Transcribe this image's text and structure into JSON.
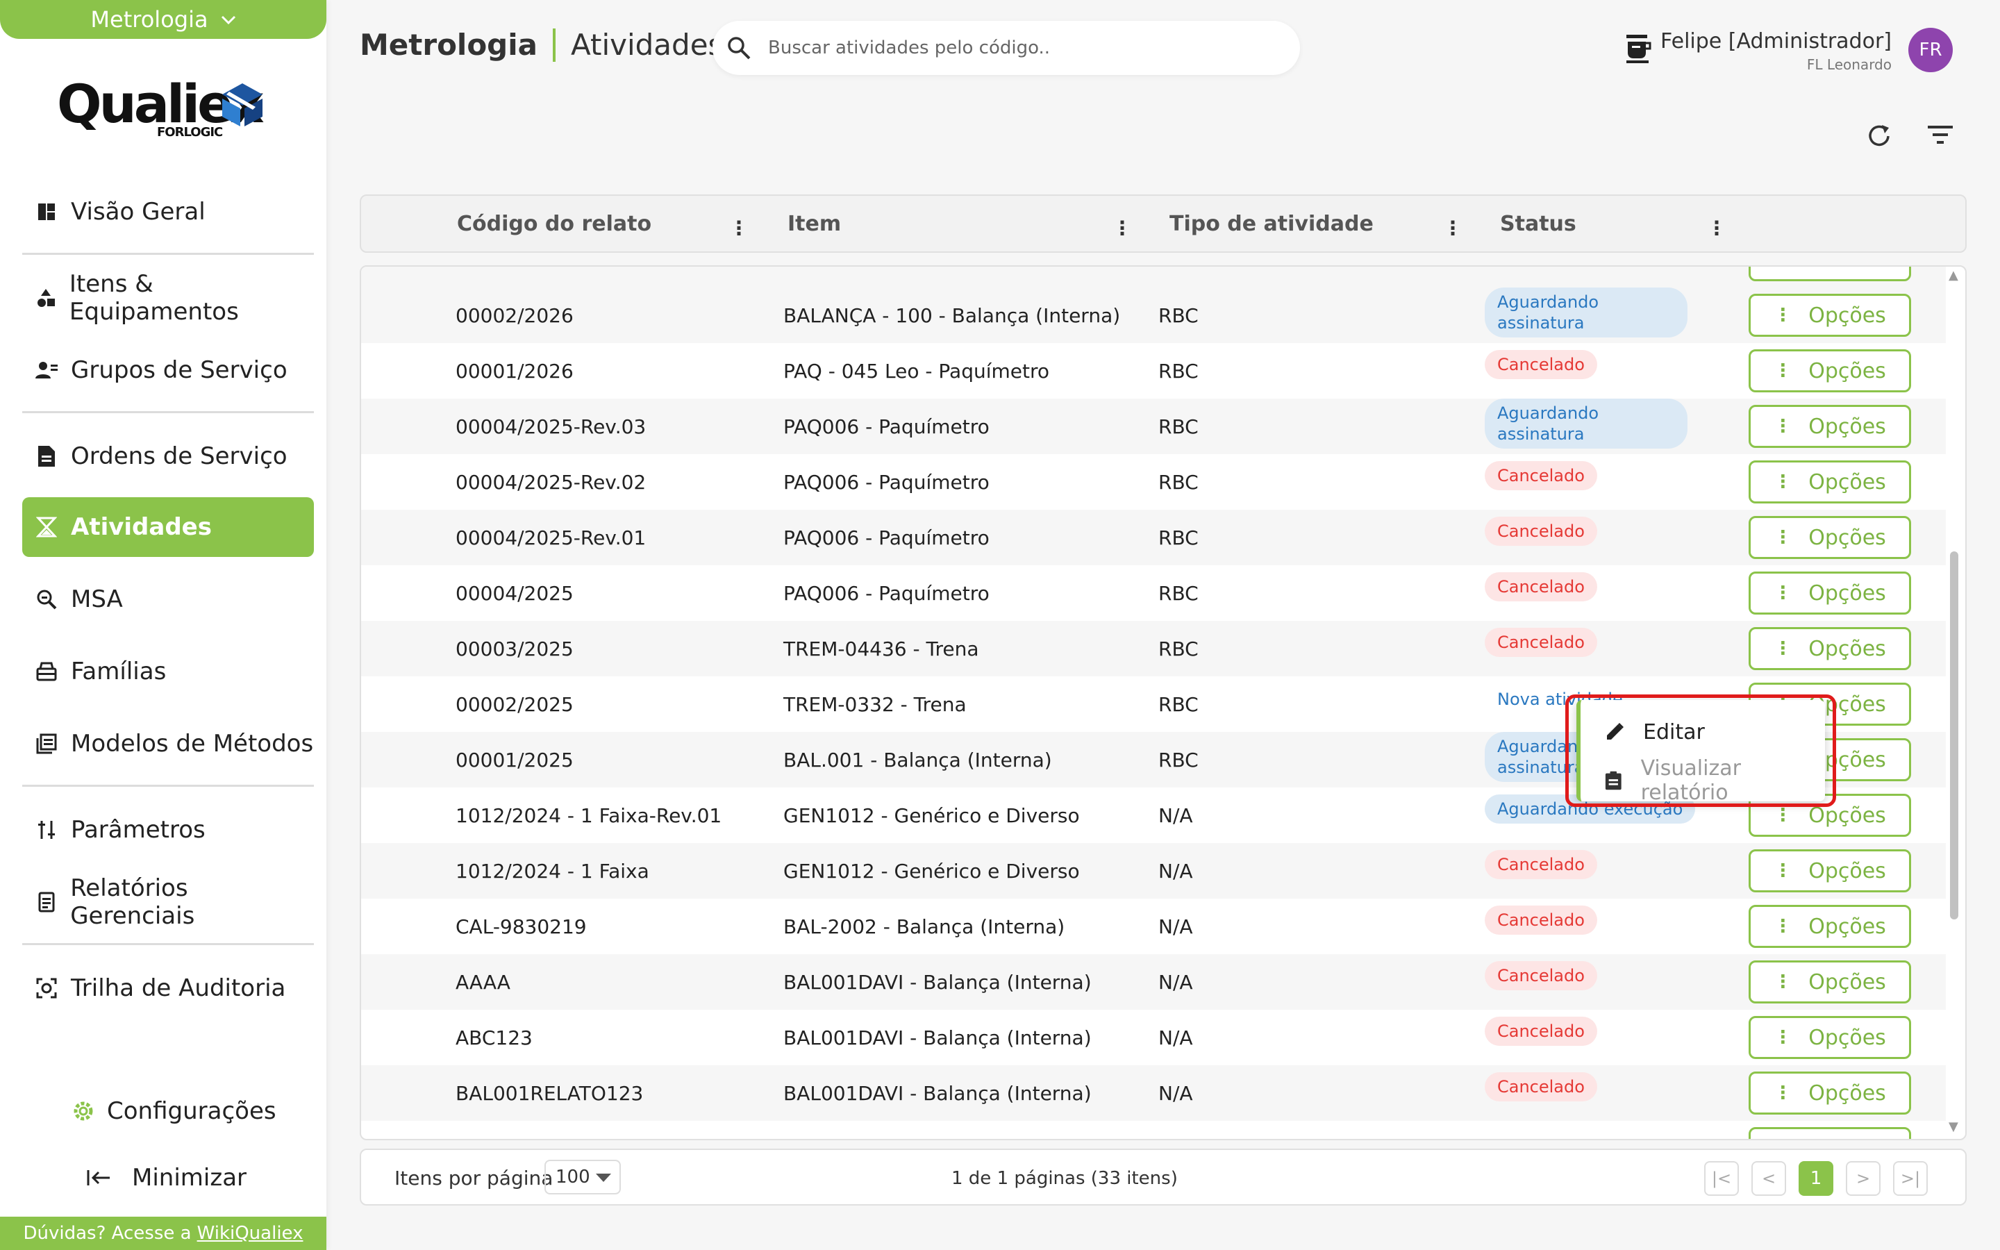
{
  "sidebar": {
    "module": "Metrologia",
    "logo": {
      "brand": "Qualiex",
      "sub": "FORLOGIC"
    },
    "items": [
      {
        "label": "Visão Geral",
        "icon": "dashboard-icon"
      },
      {
        "label": "Itens & Equipamentos",
        "icon": "shapes-icon"
      },
      {
        "label": "Grupos de Serviço",
        "icon": "people-icon"
      },
      {
        "label": "Ordens de Serviço",
        "icon": "document-icon"
      },
      {
        "label": "Atividades",
        "icon": "hourglass-icon",
        "active": true
      },
      {
        "label": "MSA",
        "icon": "zoom-icon"
      },
      {
        "label": "Famílias",
        "icon": "tray-icon"
      },
      {
        "label": "Modelos de Métodos",
        "icon": "library-icon"
      },
      {
        "label": "Parâmetros",
        "icon": "sliders-icon"
      },
      {
        "label": "Relatórios Gerenciais",
        "icon": "report-icon"
      },
      {
        "label": "Trilha de Auditoria",
        "icon": "audit-icon"
      }
    ],
    "config_label": "Configurações",
    "minimize_label": "Minimizar",
    "help_text": "Dúvidas? Acesse a",
    "help_link": "WikiQualiex"
  },
  "header": {
    "module": "Metrologia",
    "page": "Atividades",
    "search_placeholder": "Buscar atividades pelo código..",
    "user_name": "Felipe [Administrador]",
    "user_org": "FL Leonardo",
    "avatar": "FR"
  },
  "table": {
    "columns": [
      "Código do relato",
      "Item",
      "Tipo de atividade",
      "Status"
    ],
    "options_label": "Opções",
    "rows": [
      {
        "code": "00002/2026",
        "item": "BALANÇA - 100 - Balança (Interna)",
        "type": "RBC",
        "status": "Aguardando assinatura",
        "kind": "blue"
      },
      {
        "code": "00001/2026",
        "item": "PAQ - 045 Leo - Paquímetro",
        "type": "RBC",
        "status": "Cancelado",
        "kind": "red"
      },
      {
        "code": "00004/2025-Rev.03",
        "item": "PAQ006 - Paquímetro",
        "type": "RBC",
        "status": "Aguardando assinatura",
        "kind": "blue"
      },
      {
        "code": "00004/2025-Rev.02",
        "item": "PAQ006 - Paquímetro",
        "type": "RBC",
        "status": "Cancelado",
        "kind": "red"
      },
      {
        "code": "00004/2025-Rev.01",
        "item": "PAQ006 - Paquímetro",
        "type": "RBC",
        "status": "Cancelado",
        "kind": "red"
      },
      {
        "code": "00004/2025",
        "item": "PAQ006 - Paquímetro",
        "type": "RBC",
        "status": "Cancelado",
        "kind": "red"
      },
      {
        "code": "00003/2025",
        "item": "TREM-04436 - Trena",
        "type": "RBC",
        "status": "Cancelado",
        "kind": "red"
      },
      {
        "code": "00002/2025",
        "item": "TREM-0332 - Trena",
        "type": "RBC",
        "status": "Nova atividade",
        "kind": "plain"
      },
      {
        "code": "00001/2025",
        "item": "BAL.001 - Balança (Interna)",
        "type": "RBC",
        "status": "Aguardando assinatura",
        "kind": "blue"
      },
      {
        "code": "1012/2024 - 1 Faixa-Rev.01",
        "item": "GEN1012 - Genérico e Diverso",
        "type": "N/A",
        "status": "Aguardando execução",
        "kind": "blue1"
      },
      {
        "code": "1012/2024 - 1 Faixa",
        "item": "GEN1012 - Genérico e Diverso",
        "type": "N/A",
        "status": "Cancelado",
        "kind": "red"
      },
      {
        "code": "CAL-9830219",
        "item": "BAL-2002 - Balança (Interna)",
        "type": "N/A",
        "status": "Cancelado",
        "kind": "red"
      },
      {
        "code": "AAAA",
        "item": "BAL001DAVI - Balança (Interna)",
        "type": "N/A",
        "status": "Cancelado",
        "kind": "red"
      },
      {
        "code": "ABC123",
        "item": "BAL001DAVI - Balança (Interna)",
        "type": "N/A",
        "status": "Cancelado",
        "kind": "red"
      },
      {
        "code": "BAL001RELATO123",
        "item": "BAL001DAVI - Balança (Interna)",
        "type": "N/A",
        "status": "Cancelado",
        "kind": "red"
      }
    ]
  },
  "context_menu": {
    "edit": "Editar",
    "view_report": "Visualizar relatório"
  },
  "pagination": {
    "items_per_page_label": "Itens por página",
    "items_per_page": "100",
    "info": "1 de 1 páginas (33 itens)",
    "current_page": "1"
  },
  "colors": {
    "accent": "#8bc34a",
    "cancel": "#e53935",
    "info": "#2a78c0"
  }
}
